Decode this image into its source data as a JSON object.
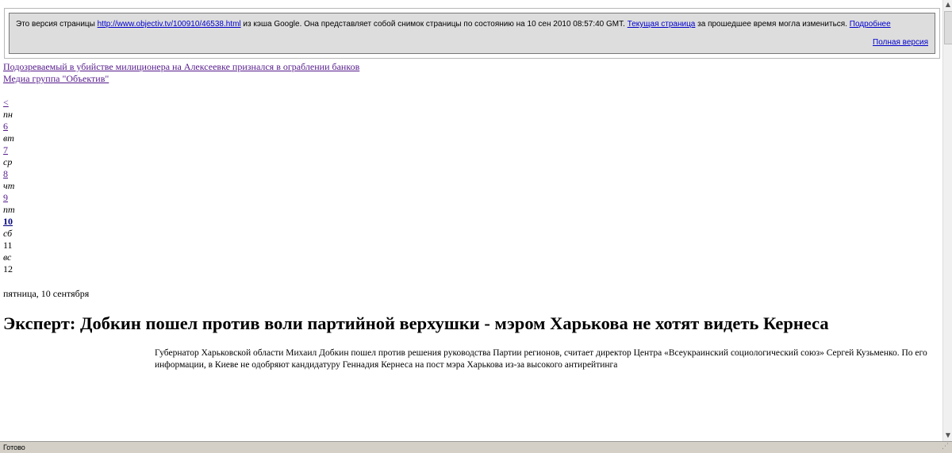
{
  "cache_banner": {
    "prefix": "Это версия страницы",
    "url": "http://www.objectiv.tv/100910/46538.html",
    "middle": "из кэша Google. Она представляет собой снимок страницы по состоянию на 10 сен 2010 08:57:40 GMT.",
    "current_page_link": "Текущая страница",
    "after_current": "за прошедшее время могла измениться.",
    "more_link": "Подробнее",
    "full_version_link": "Полная версия"
  },
  "top_links": [
    "Подозреваемый в убийстве милиционера на Алексеевке признался в ограблении банков",
    "Медиа группа \"Объектив\""
  ],
  "calendar": {
    "prev": "<",
    "days": [
      {
        "dow": "пн",
        "num": "6"
      },
      {
        "dow": "вт",
        "num": "7"
      },
      {
        "dow": "ср",
        "num": "8"
      },
      {
        "dow": "чт",
        "num": "9"
      },
      {
        "dow": "пт",
        "num": "10"
      },
      {
        "dow": "сб",
        "num": "11"
      },
      {
        "dow": "вс",
        "num": "12"
      }
    ]
  },
  "article": {
    "date": "пятница, 10 сентября",
    "headline": "Эксперт: Добкин пошел против воли партийной верхушки - мэром Харькова не хотят видеть Кернеса",
    "lead": "Губернатор Харьковской области Михаил Добкин пошел против решения руководства Партии регионов, считает директор Центра «Всеукраинский социологический союз» Сергей Кузьменко. По его информации, в Киеве не одобряют кандидатуру Геннадия Кернеса на пост мэра Харькова из-за высокого антирейтинга"
  },
  "status_bar": {
    "text": "Готово"
  },
  "scrollbar": {
    "up_icon": "▲",
    "down_icon": "▼"
  },
  "status_grip_icon": "⋰"
}
